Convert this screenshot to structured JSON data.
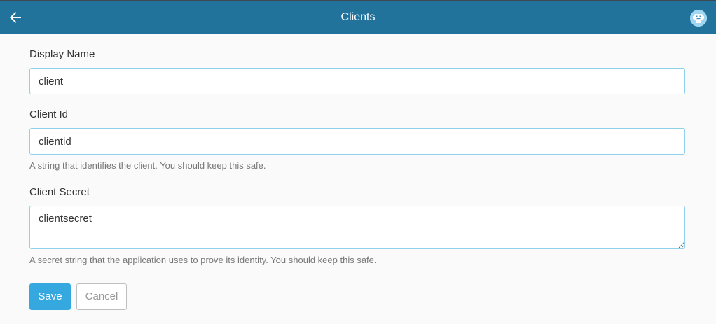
{
  "header": {
    "title": "Clients",
    "back_icon": "arrow-left-icon",
    "avatar_icon": "robot-avatar-icon",
    "bar_color": "#21739c"
  },
  "form": {
    "display_name": {
      "label": "Display Name",
      "value": "client"
    },
    "client_id": {
      "label": "Client Id",
      "value": "clientid",
      "help": "A string that identifies the client. You should keep this safe."
    },
    "client_secret": {
      "label": "Client Secret",
      "value": "clientsecret",
      "help": "A secret string that the application uses to prove its identity. You should keep this safe."
    }
  },
  "actions": {
    "save_label": "Save",
    "cancel_label": "Cancel",
    "accent_color": "#36a8e0"
  }
}
